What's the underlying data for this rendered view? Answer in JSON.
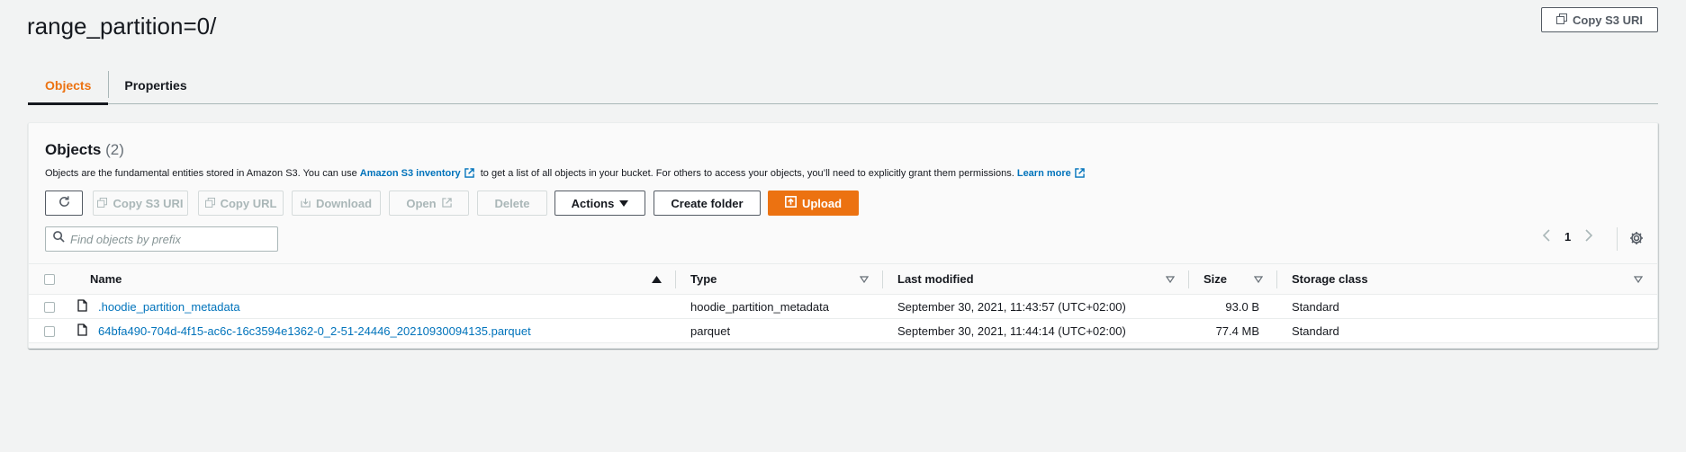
{
  "header": {
    "title": "range_partition=0/",
    "copy_s3_uri_label": "Copy S3 URI"
  },
  "tabs": [
    {
      "label": "Objects",
      "active": true
    },
    {
      "label": "Properties",
      "active": false
    }
  ],
  "objects": {
    "title": "Objects",
    "count": "(2)",
    "description": {
      "part1": "Objects are the fundamental entities stored in Amazon S3. You can use",
      "link1": "Amazon S3 inventory",
      "part2": "to get a list of all objects in your bucket. For others to access your objects, you’ll need to explicitly grant them permissions.",
      "link2": "Learn more"
    },
    "toolbar": {
      "refresh_icon": "refresh-icon",
      "copy_s3_uri": "Copy S3 URI",
      "copy_url": "Copy URL",
      "download": "Download",
      "open": "Open",
      "delete": "Delete",
      "actions": "Actions",
      "create_folder": "Create folder",
      "upload": "Upload"
    },
    "search": {
      "placeholder": "Find objects by prefix",
      "value": ""
    },
    "pagination": {
      "current_page": "1"
    },
    "table": {
      "columns": [
        "Name",
        "Type",
        "Last modified",
        "Size",
        "Storage class"
      ],
      "rows": [
        {
          "name": ".hoodie_partition_metadata",
          "type": "hoodie_partition_metadata",
          "last_modified": "September 30, 2021, 11:43:57 (UTC+02:00)",
          "size": "93.0 B",
          "storage_class": "Standard"
        },
        {
          "name": "64bfa490-704d-4f15-ac6c-16c3594e1362-0_2-51-24446_20210930094135.parquet",
          "type": "parquet",
          "last_modified": "September 30, 2021, 11:44:14 (UTC+02:00)",
          "size": "77.4 MB",
          "storage_class": "Standard"
        }
      ]
    }
  },
  "colors": {
    "accent_orange": "#ec7211",
    "link_blue": "#0073bb",
    "text_dark": "#16191f",
    "disabled_gray": "#aab7b8"
  }
}
